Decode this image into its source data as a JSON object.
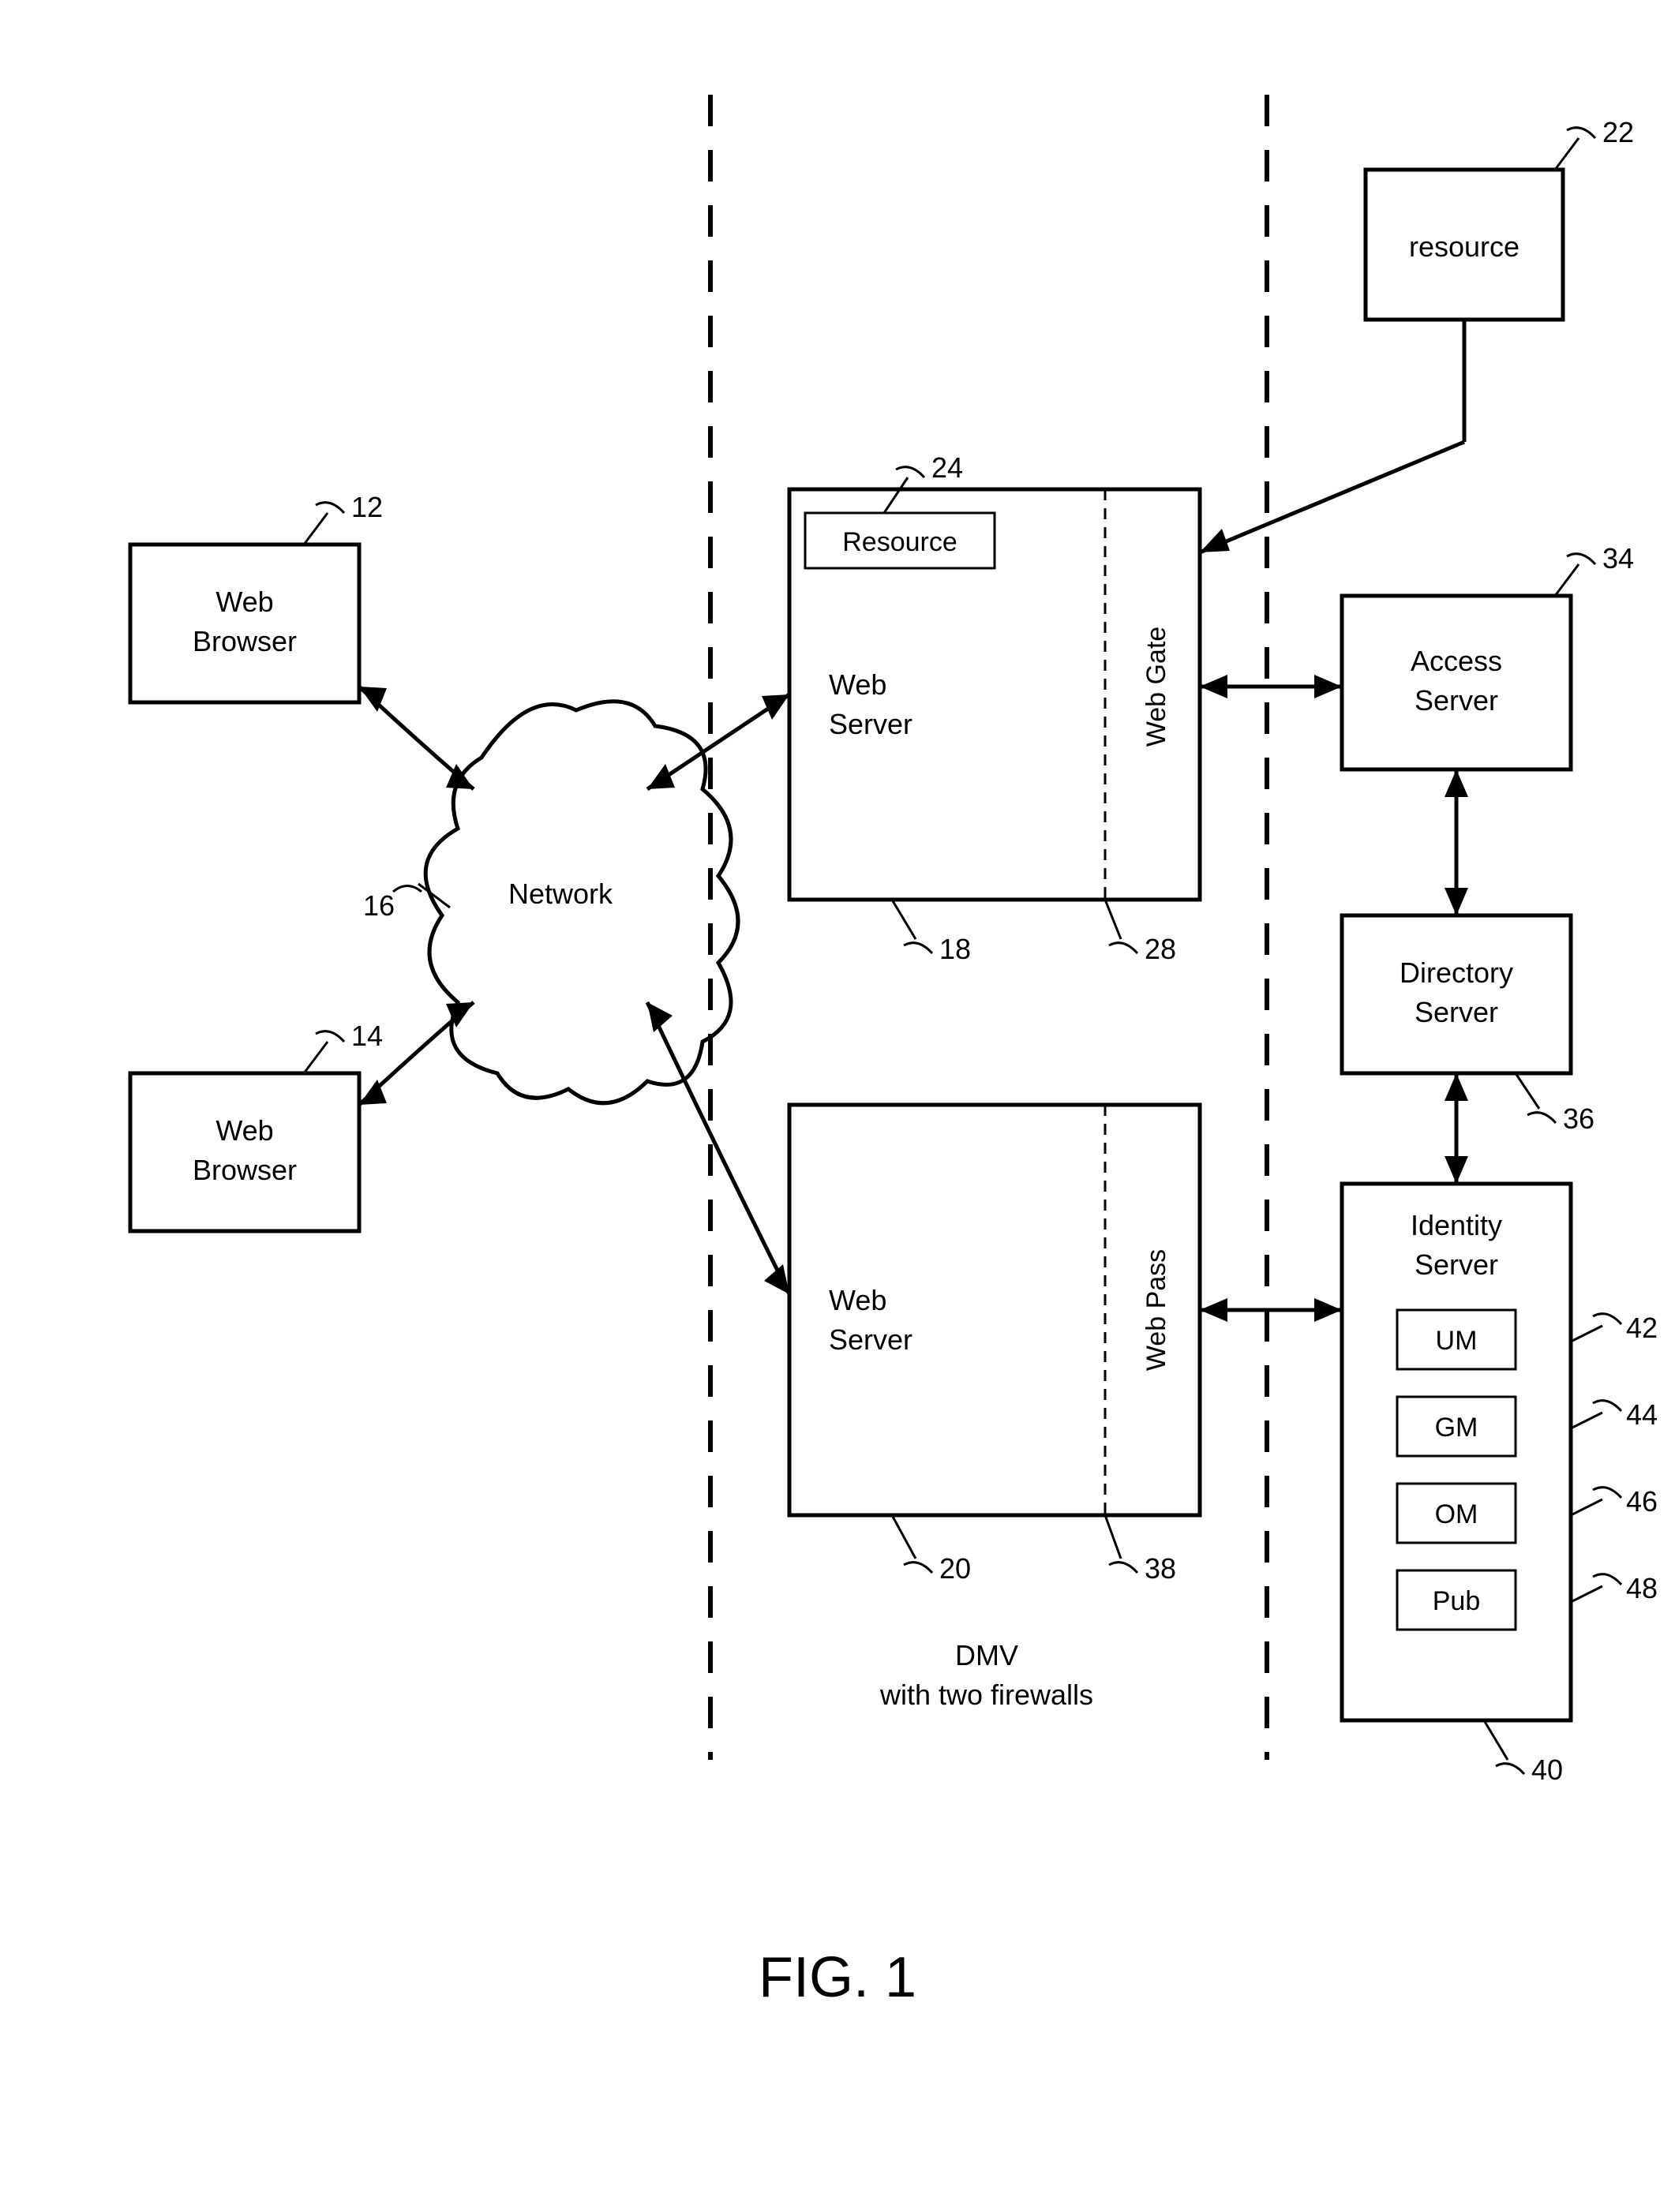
{
  "figure": {
    "caption": "FIG. 1"
  },
  "dmz": {
    "line1": "DMV",
    "line2": "with  two firewalls"
  },
  "nodes": {
    "browser1": {
      "l1": "Web",
      "l2": "Browser",
      "ref": "12"
    },
    "browser2": {
      "l1": "Web",
      "l2": "Browser",
      "ref": "14"
    },
    "network": {
      "label": "Network",
      "ref": "16"
    },
    "webserver1": {
      "l1": "Web",
      "l2": "Server",
      "ref": "18",
      "gate": "Web Gate",
      "gateRef": "28",
      "resInner": "Resource",
      "resInnerRef": "24"
    },
    "webserver2": {
      "l1": "Web",
      "l2": "Server",
      "ref": "20",
      "pass": "Web Pass",
      "passRef": "38"
    },
    "resource": {
      "label": "resource",
      "ref": "22"
    },
    "access": {
      "l1": "Access",
      "l2": "Server",
      "ref": "34"
    },
    "directory": {
      "l1": "Directory",
      "l2": "Server",
      "ref": "36"
    },
    "identity": {
      "l1": "Identity",
      "l2": "Server",
      "ref": "40",
      "modules": {
        "um": "UM",
        "gm": "GM",
        "om": "OM",
        "pub": "Pub"
      },
      "moduleRefs": {
        "um": "42",
        "gm": "44",
        "om": "46",
        "pub": "48"
      }
    }
  }
}
